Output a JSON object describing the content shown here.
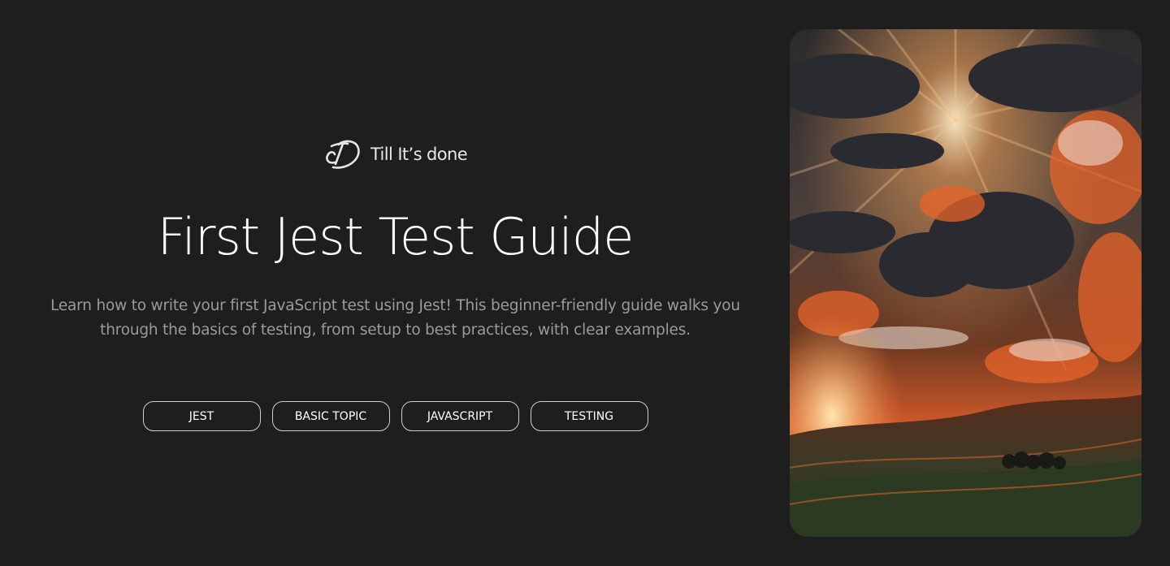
{
  "brand": {
    "name": "Till It’s done",
    "logo_icon": "td-monogram-logo"
  },
  "hero": {
    "title": "First Jest Test Guide",
    "description": "Learn how to write your first JavaScript test using Jest! This beginner-friendly guide walks you through the basics of testing, from setup to best practices, with clear examples."
  },
  "tags": [
    {
      "label": "JEST"
    },
    {
      "label": "BASIC TOPIC"
    },
    {
      "label": "JAVASCRIPT"
    },
    {
      "label": "TESTING"
    }
  ],
  "colors": {
    "background": "#1e1e1e",
    "text": "#ffffff",
    "muted_text": "#9a9a9a",
    "tag_border": "#cfcfcf",
    "sunset_orange": "#e8642a"
  }
}
